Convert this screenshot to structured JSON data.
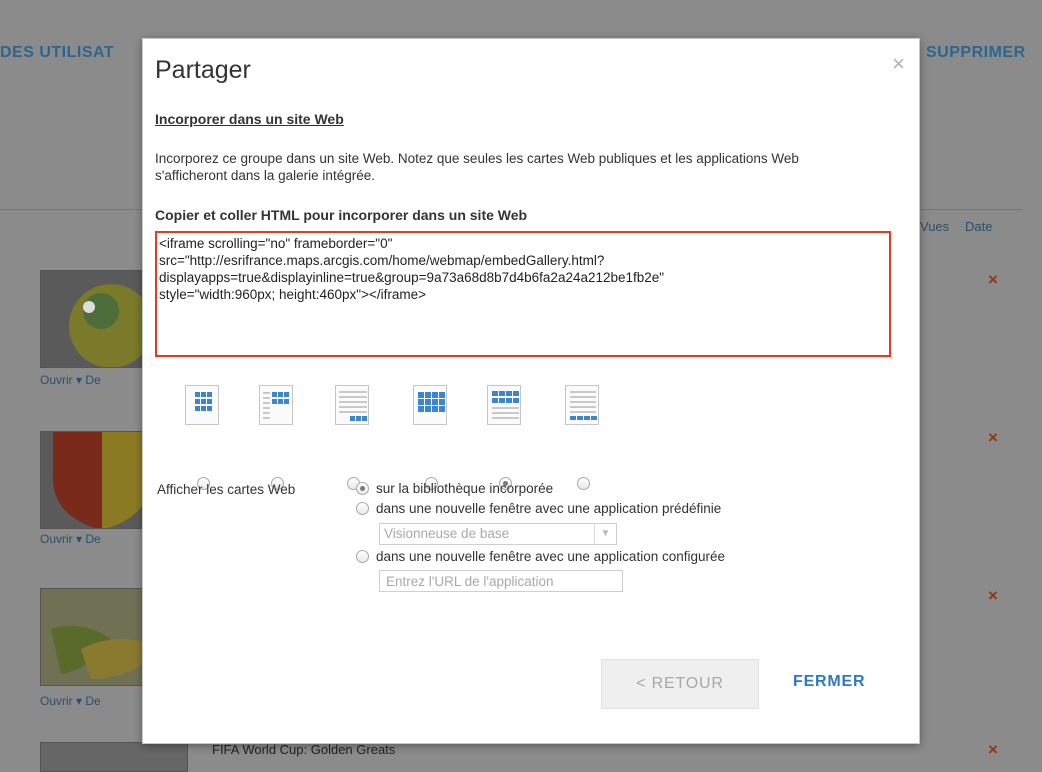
{
  "background": {
    "nav_left": "DES UTILISAT",
    "nav_right": "SUPPRIMER",
    "col_views": "Vues",
    "col_date": "Date",
    "remove_mark": "×",
    "open_link": "Ouvrir ▾",
    "open_link_trail": "De",
    "last_item_title": "FIFA World Cup: Golden Greats"
  },
  "dialog": {
    "title": "Partager",
    "close_symbol": "×",
    "section_heading": "Incorporer dans un site Web",
    "description": "Incorporez ce groupe dans un site Web. Notez que seules les cartes Web publiques et les applications Web s'afficheront dans la galerie intégrée.",
    "code_label": "Copier et coller HTML pour incorporer dans un site Web",
    "code": "<iframe scrolling=\"no\" frameborder=\"0\"\nsrc=\"http://esrifrance.maps.arcgis.com/home/webmap/embedGallery.html?\ndisplayapps=true&displayinline=true&group=9a73a68d8b7d4b6fa2a24a212be1fb2e\"\nstyle=\"width:960px; height:460px\"></iframe>",
    "layouts": [
      {
        "name": "grid-centered",
        "selected": false
      },
      {
        "name": "grid-right",
        "selected": false
      },
      {
        "name": "list-with-footer-grid",
        "selected": false
      },
      {
        "name": "grid-full",
        "selected": false
      },
      {
        "name": "grid-top",
        "selected": true
      },
      {
        "name": "list-lines",
        "selected": false
      }
    ],
    "display_label": "Afficher les cartes Web",
    "display_options": [
      {
        "label": "sur la bibliothèque incorporée",
        "selected": true
      },
      {
        "label": "dans une nouvelle fenêtre avec une application prédéfinie",
        "selected": false
      },
      {
        "label": "dans une nouvelle fenêtre avec une application configurée",
        "selected": false
      }
    ],
    "predefined_app_select": "Visionneuse de base",
    "app_url_placeholder": "Entrez l'URL de l'application",
    "back_button": "< RETOUR",
    "close_button": "FERMER",
    "colors": {
      "code_border": "#e03c1e",
      "link_blue": "#2d79c2"
    }
  }
}
